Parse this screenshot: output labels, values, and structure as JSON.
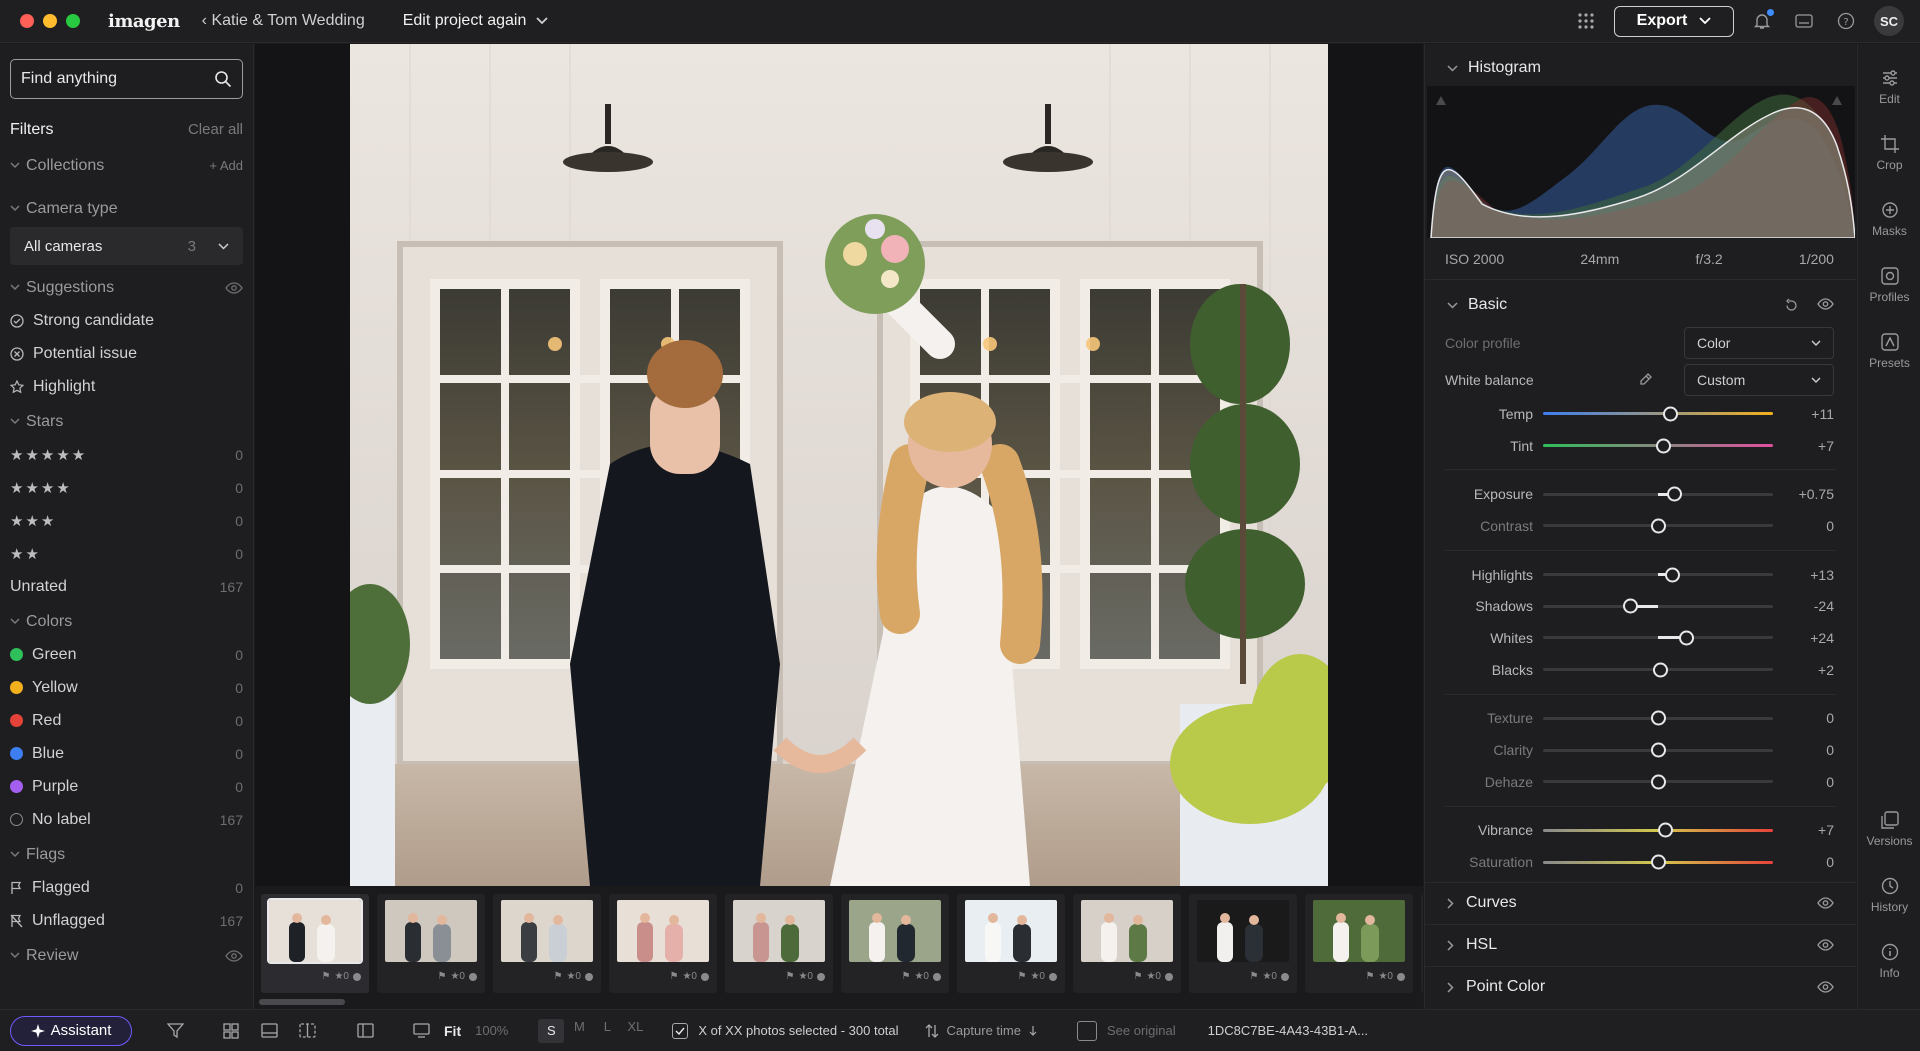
{
  "titlebar": {
    "logo": "imagen",
    "breadcrumb": "‹ Katie & Tom Wedding",
    "project": "Edit project again",
    "export_label": "Export",
    "avatar_initials": "SC"
  },
  "sidebar": {
    "search_placeholder": "Find anything",
    "filters_label": "Filters",
    "clear_all": "Clear all",
    "collections": {
      "label": "Collections",
      "add": "+ Add"
    },
    "camera_type": {
      "label": "Camera type",
      "selected": "All cameras",
      "count": "3"
    },
    "suggestions": {
      "label": "Suggestions",
      "items": [
        {
          "label": "Strong candidate"
        },
        {
          "label": "Potential issue"
        },
        {
          "label": "Highlight"
        }
      ]
    },
    "stars": {
      "label": "Stars",
      "items": [
        {
          "stars": "★★★★★",
          "count": "0"
        },
        {
          "stars": "★★★★",
          "count": "0"
        },
        {
          "stars": "★★★",
          "count": "0"
        },
        {
          "stars": "★★",
          "count": "0"
        },
        {
          "stars": "Unrated",
          "count": "167"
        }
      ]
    },
    "colors": {
      "label": "Colors",
      "items": [
        {
          "label": "Green",
          "count": "0",
          "color": "#2fbf5b"
        },
        {
          "label": "Yellow",
          "count": "0",
          "color": "#f2b01e"
        },
        {
          "label": "Red",
          "count": "0",
          "color": "#e5433a"
        },
        {
          "label": "Blue",
          "count": "0",
          "color": "#3d7ef0"
        },
        {
          "label": "Purple",
          "count": "0",
          "color": "#a45ff0"
        },
        {
          "label": "No label",
          "count": "167",
          "color": "none"
        }
      ]
    },
    "flags": {
      "label": "Flags",
      "items": [
        {
          "label": "Flagged",
          "count": "0"
        },
        {
          "label": "Unflagged",
          "count": "167"
        }
      ]
    },
    "review": {
      "label": "Review"
    }
  },
  "filmstrip": {
    "thumb_meta": "★0"
  },
  "right_panel": {
    "histogram": {
      "label": "Histogram"
    },
    "exif": {
      "iso": "ISO 2000",
      "focal": "24mm",
      "aperture": "f/3.2",
      "shutter": "1/200"
    },
    "basic": {
      "label": "Basic",
      "color_profile": {
        "label": "Color profile",
        "value": "Color"
      },
      "white_balance": {
        "label": "White balance",
        "value": "Custom"
      },
      "groups": [
        [
          {
            "label": "Temp",
            "value": "+11",
            "pos": 0.55,
            "track": "temp"
          },
          {
            "label": "Tint",
            "value": "+7",
            "pos": 0.52,
            "track": "tint"
          }
        ],
        [
          {
            "label": "Exposure",
            "value": "+0.75",
            "pos": 0.57,
            "track": "plain"
          },
          {
            "label": "Contrast",
            "value": "0",
            "pos": 0.5,
            "track": "plain"
          }
        ],
        [
          {
            "label": "Highlights",
            "value": "+13",
            "pos": 0.56,
            "track": "plain"
          },
          {
            "label": "Shadows",
            "value": "-24",
            "pos": 0.38,
            "track": "plain"
          },
          {
            "label": "Whites",
            "value": "+24",
            "pos": 0.62,
            "track": "plain"
          },
          {
            "label": "Blacks",
            "value": "+2",
            "pos": 0.51,
            "track": "plain"
          }
        ],
        [
          {
            "label": "Texture",
            "value": "0",
            "pos": 0.5,
            "track": "plain"
          },
          {
            "label": "Clarity",
            "value": "0",
            "pos": 0.5,
            "track": "plain"
          },
          {
            "label": "Dehaze",
            "value": "0",
            "pos": 0.5,
            "track": "plain"
          }
        ],
        [
          {
            "label": "Vibrance",
            "value": "+7",
            "pos": 0.53,
            "track": "rainbow"
          },
          {
            "label": "Saturation",
            "value": "0",
            "pos": 0.5,
            "track": "rainbow"
          }
        ]
      ]
    },
    "curves": "Curves",
    "hsl": "HSL",
    "point_color": "Point Color"
  },
  "rail": {
    "edit": "Edit",
    "crop": "Crop",
    "masks": "Masks",
    "profiles": "Profiles",
    "presets": "Presets",
    "versions": "Versions",
    "history": "History",
    "info": "Info"
  },
  "bottombar": {
    "assistant": "Assistant",
    "fit": "Fit",
    "zoom": "100%",
    "sizes": [
      "S",
      "M",
      "L",
      "XL"
    ],
    "selection": "X of XX photos selected - 300 total",
    "sort": "Capture time",
    "see_original": "See original",
    "file_id": "1DC8C7BE-4A43-43B1-A..."
  }
}
